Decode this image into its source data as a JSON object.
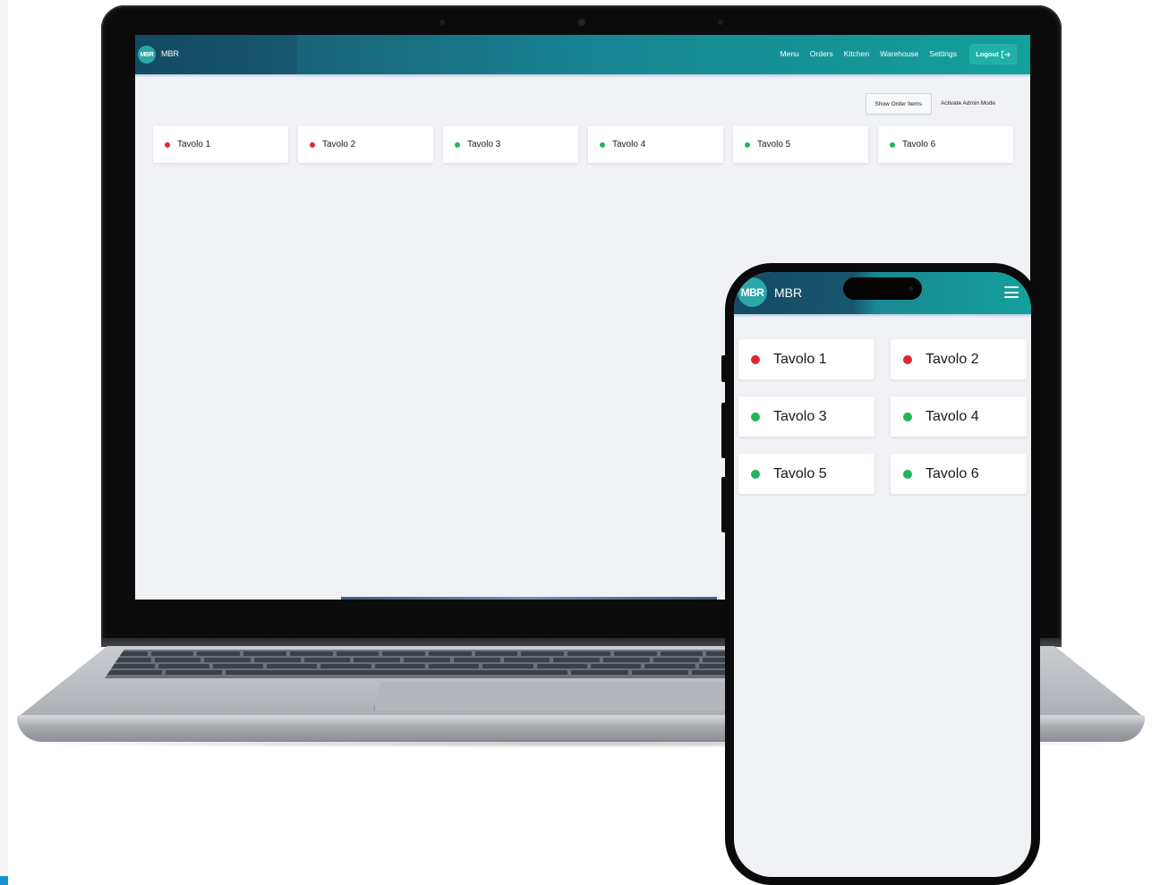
{
  "app": {
    "brand_logo_text": "MBR",
    "brand_name": "MBR"
  },
  "desktop": {
    "nav_links": [
      "Menu",
      "Orders",
      "Kitchen",
      "Warehouse",
      "Settings"
    ],
    "logout_label": "Logout",
    "toolbar": {
      "show_order_items_label": "Show Order Items",
      "activate_admin_mode_label": "Activate Admin Mode"
    }
  },
  "tables": [
    {
      "label": "Tavolo 1",
      "status": "occupied",
      "color": "#d92b2b"
    },
    {
      "label": "Tavolo 2",
      "status": "occupied",
      "color": "#d92b2b"
    },
    {
      "label": "Tavolo 3",
      "status": "free",
      "color": "#23b35a"
    },
    {
      "label": "Tavolo 4",
      "status": "free",
      "color": "#23b35a"
    },
    {
      "label": "Tavolo 5",
      "status": "free",
      "color": "#23b35a"
    },
    {
      "label": "Tavolo 6",
      "status": "free",
      "color": "#23b35a"
    }
  ],
  "mobile": {
    "menu_icon": "hamburger-icon"
  },
  "colors": {
    "nav_dark": "#124a63",
    "nav_teal": "#13a19a",
    "occupied": "#d92b2b",
    "free": "#23b35a",
    "background": "#f1f2f5"
  }
}
